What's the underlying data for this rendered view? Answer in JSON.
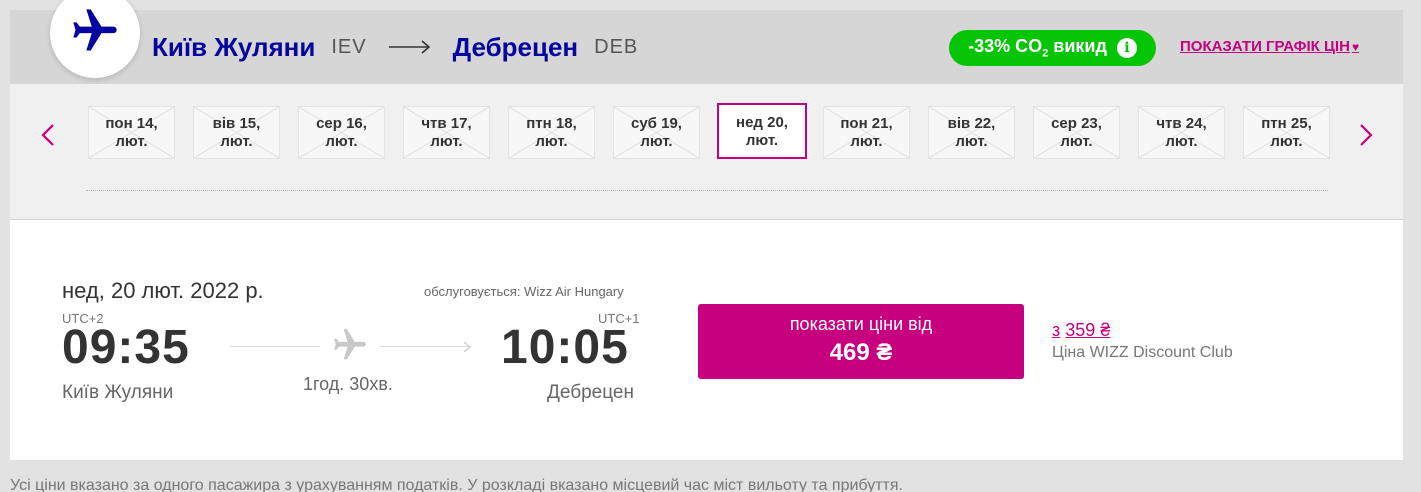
{
  "colors": {
    "brand_blue": "#06049f",
    "accent_magenta": "#c6007e",
    "co2_green": "#06c406"
  },
  "route": {
    "origin_city": "Київ Жуляни",
    "origin_code": "IEV",
    "destination_city": "Дебрецен",
    "destination_code": "DEB",
    "header_icon": "airplane-icon",
    "arrow_icon": "long-arrow-right-icon"
  },
  "co2": {
    "label_prefix": "-33% CO",
    "label_sub": "2",
    "label_suffix": " викид",
    "info_symbol": "i",
    "info_icon": "info-icon"
  },
  "price_graph": {
    "label": "ПОКАЗАТИ ГРАФІК ЦІН",
    "heart": "♥",
    "icon": "heart-icon"
  },
  "date_nav": {
    "prev_icon": "chevron-left-icon",
    "next_icon": "chevron-right-icon",
    "dates": [
      {
        "day": "пон 14,",
        "month": "лют.",
        "selected": false
      },
      {
        "day": "вів 15,",
        "month": "лют.",
        "selected": false
      },
      {
        "day": "сер 16,",
        "month": "лют.",
        "selected": false
      },
      {
        "day": "чтв 17,",
        "month": "лют.",
        "selected": false
      },
      {
        "day": "птн 18,",
        "month": "лют.",
        "selected": false
      },
      {
        "day": "суб 19,",
        "month": "лют.",
        "selected": false
      },
      {
        "day": "нед 20,",
        "month": "лют.",
        "selected": true
      },
      {
        "day": "пон 21,",
        "month": "лют.",
        "selected": false
      },
      {
        "day": "вів 22,",
        "month": "лют.",
        "selected": false
      },
      {
        "day": "сер 23,",
        "month": "лют.",
        "selected": false
      },
      {
        "day": "чтв 24,",
        "month": "лют.",
        "selected": false
      },
      {
        "day": "птн 25,",
        "month": "лют.",
        "selected": false
      }
    ]
  },
  "flight": {
    "date": "нед, 20 лют. 2022 р.",
    "operated_by": "обслуговується: Wizz Air Hungary",
    "departure": {
      "utc": "UTC+2",
      "time": "09:35",
      "airport": "Київ Жуляни"
    },
    "arrival": {
      "utc": "UTC+1",
      "time": "10:05",
      "airport": "Дебрецен"
    },
    "duration": "1год. 30хв.",
    "plane_icon": "airplane-icon",
    "price_button": {
      "label": "показати ціни від",
      "amount": "469 ₴"
    },
    "club": {
      "prefix": "з",
      "price": "359 ₴",
      "label": "Ціна WIZZ Discount Club"
    }
  },
  "footnote": "Усі ціни вказано за одного пасажира з урахуванням податків. У розкладі вказано місцевий час міст вильоту та прибуття."
}
